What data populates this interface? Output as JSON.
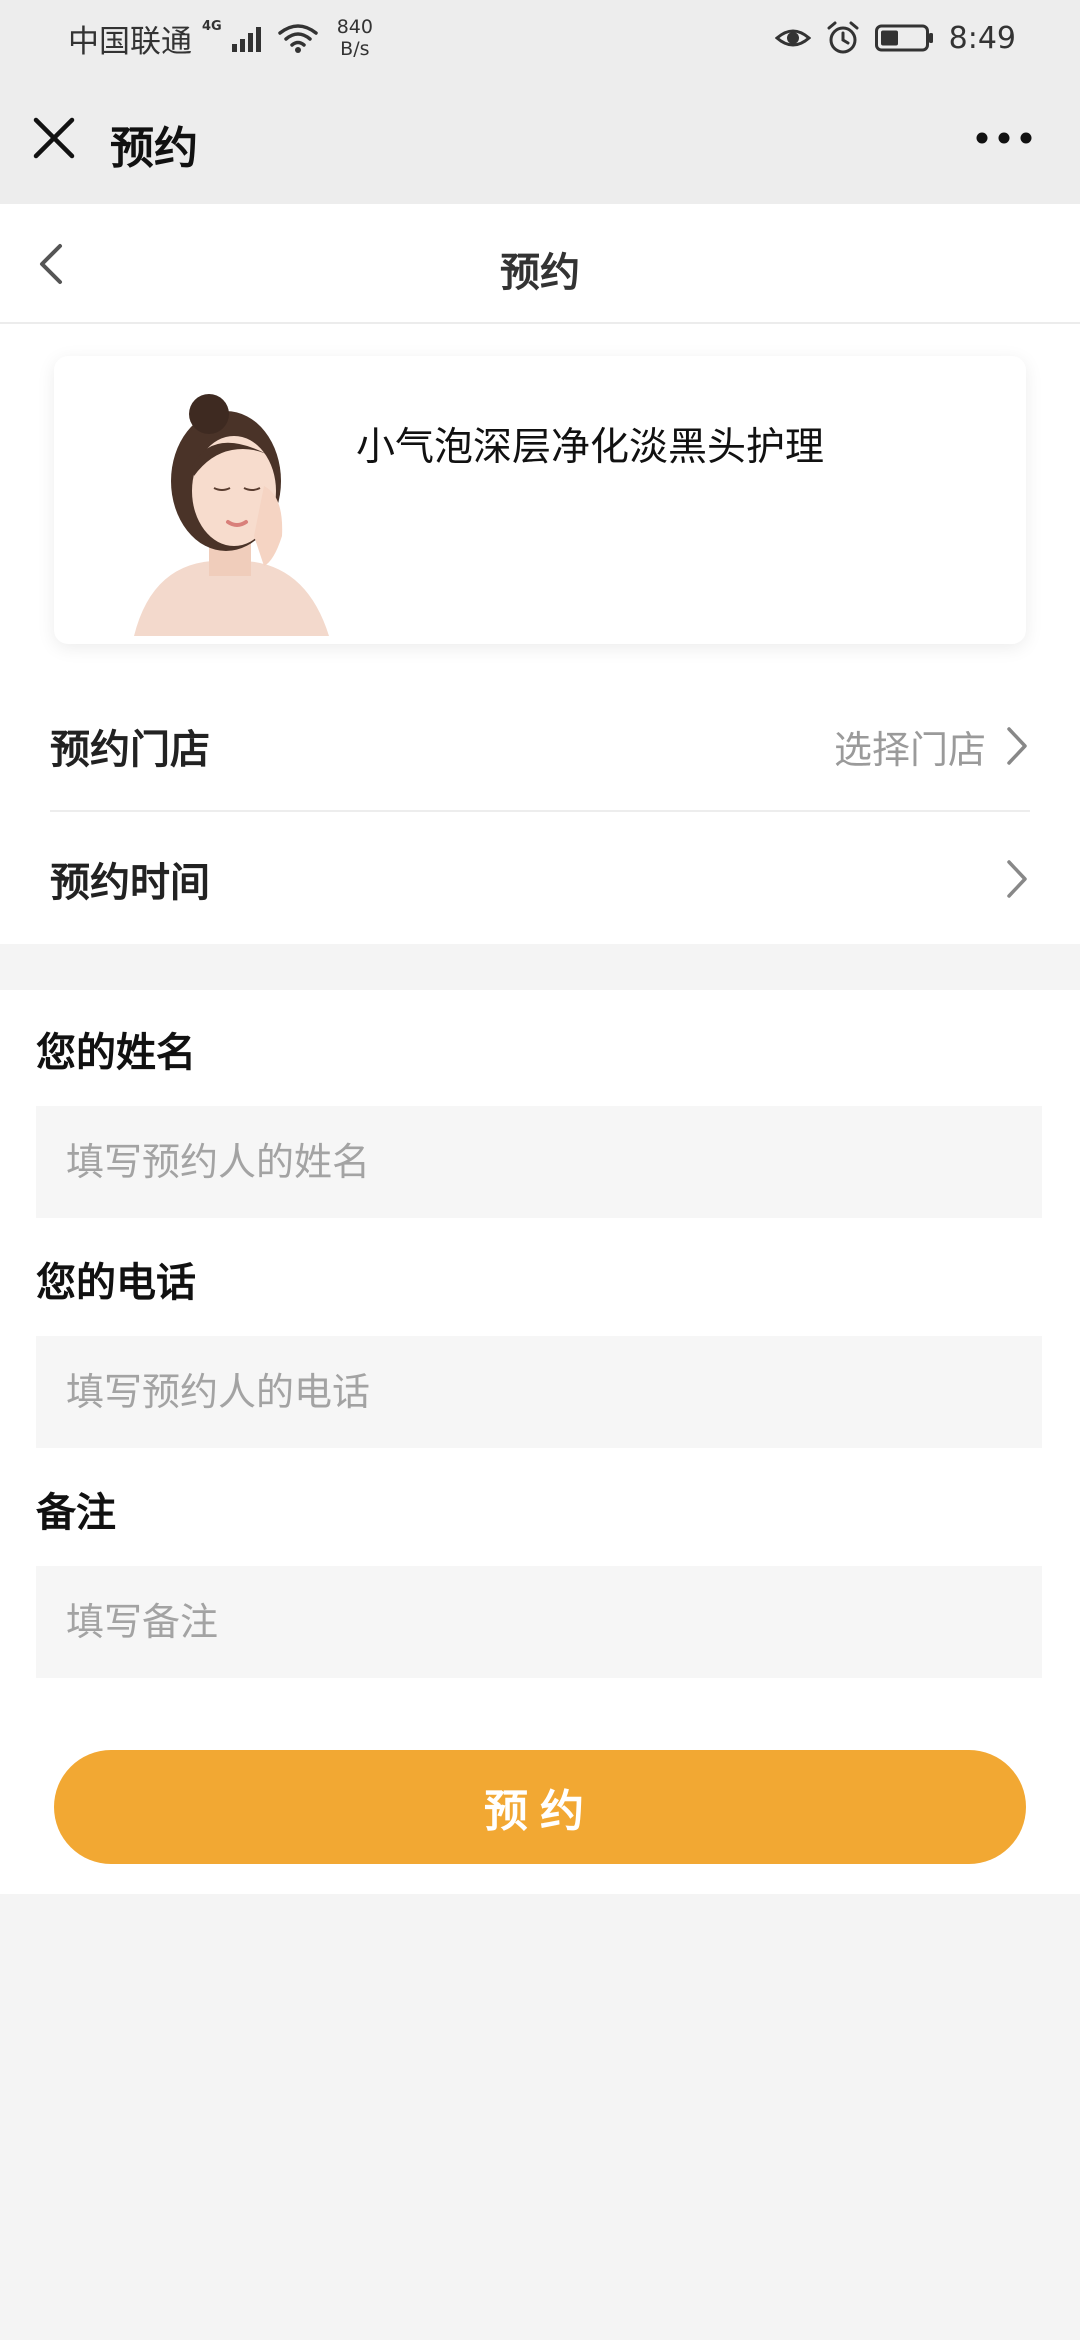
{
  "status_bar": {
    "carrier": "中国联通",
    "network_type": "4G",
    "speed_value": "840",
    "speed_unit": "B/s",
    "time": "8:49",
    "icons": [
      "signal-icon",
      "wifi-icon",
      "eye-icon",
      "alarm-icon",
      "battery-icon"
    ]
  },
  "top_bar": {
    "title": "预约",
    "close_icon": "close-icon",
    "more_icon": "more-icon"
  },
  "header": {
    "title": "预约",
    "back_icon": "chevron-left-icon"
  },
  "product": {
    "name": "小气泡深层净化淡黑头护理"
  },
  "rows": {
    "store": {
      "label": "预约门店",
      "value": "选择门店"
    },
    "time": {
      "label": "预约时间",
      "value": ""
    }
  },
  "form": {
    "name": {
      "label": "您的姓名",
      "placeholder": "填写预约人的姓名"
    },
    "phone": {
      "label": "您的电话",
      "placeholder": "填写预约人的电话"
    },
    "note": {
      "label": "备注",
      "placeholder": "填写备注"
    },
    "submit_label": "预约"
  },
  "colors": {
    "accent": "#f2a833",
    "background": "#f4f4f4",
    "topbar": "#ededed"
  }
}
